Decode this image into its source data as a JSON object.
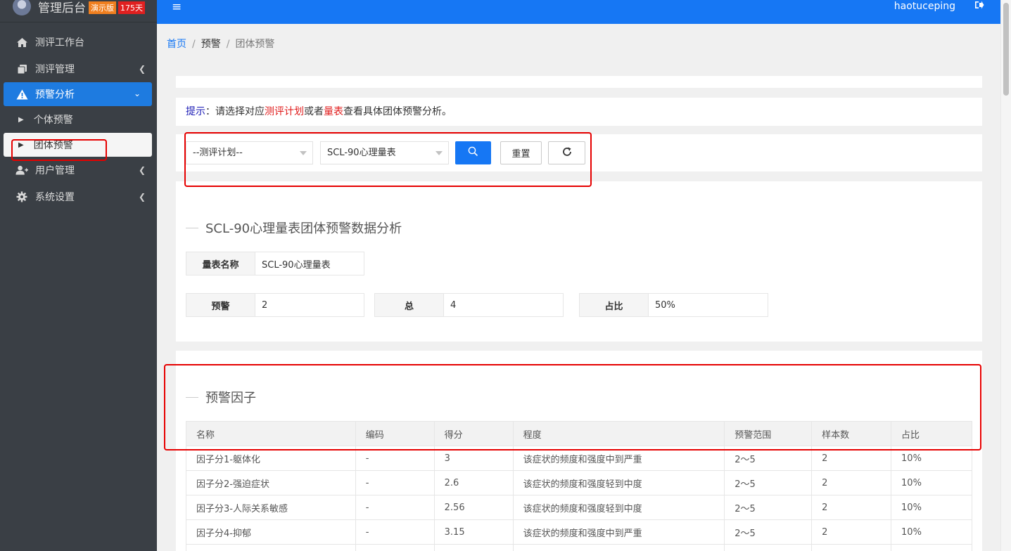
{
  "brand": {
    "title": "管理后台",
    "demo_badge": "演示版",
    "days_badge": "175天"
  },
  "sidebar": {
    "items": [
      {
        "label": "测评工作台"
      },
      {
        "label": "测评管理"
      },
      {
        "label": "预警分析"
      },
      {
        "label": "用户管理"
      },
      {
        "label": "系统设置"
      }
    ],
    "sub_items": [
      {
        "label": "个体预警"
      },
      {
        "label": "团体预警"
      }
    ]
  },
  "header": {
    "username": "haotuceping"
  },
  "breadcrumb": {
    "home": "首页",
    "level2": "预警",
    "current": "团体预警",
    "separator": "/"
  },
  "hint": {
    "prefix": "提示",
    "colon": "：请选择对应",
    "plan": "测评计划",
    "or": "或者",
    "scale": "量表",
    "suffix": "查看具体团体预警分析。"
  },
  "filters": {
    "plan_select": "--测评计划--",
    "scale_select": "SCL-90心理量表",
    "reset_label": "重置"
  },
  "summary": {
    "title": "SCL-90心理量表团体预警数据分析",
    "scale_name_key": "量表名称",
    "scale_name_value": "SCL-90心理量表",
    "warn_key": "预警",
    "warn_value": "2",
    "total_key": "总",
    "total_value": "4",
    "ratio_key": "占比",
    "ratio_value": "50%"
  },
  "factors": {
    "title": "预警因子",
    "columns": [
      "名称",
      "编码",
      "得分",
      "程度",
      "预警范围",
      "样本数",
      "占比"
    ],
    "rows": [
      [
        "因子分1-躯体化",
        "-",
        "3",
        "该症状的频度和强度中到严重",
        "2～5",
        "2",
        "10%"
      ],
      [
        "因子分2-强迫症状",
        "-",
        "2.6",
        "该症状的频度和强度轻到中度",
        "2～5",
        "2",
        "10%"
      ],
      [
        "因子分3-人际关系敏感",
        "-",
        "2.56",
        "该症状的频度和强度轻到中度",
        "2～5",
        "2",
        "10%"
      ],
      [
        "因子分4-抑郁",
        "-",
        "3.15",
        "该症状的频度和强度中到严重",
        "2～5",
        "2",
        "10%"
      ]
    ]
  },
  "colors": {
    "primary": "#1677f4",
    "sidebar_bg": "#3a3f45",
    "highlight_red": "#e60000"
  }
}
